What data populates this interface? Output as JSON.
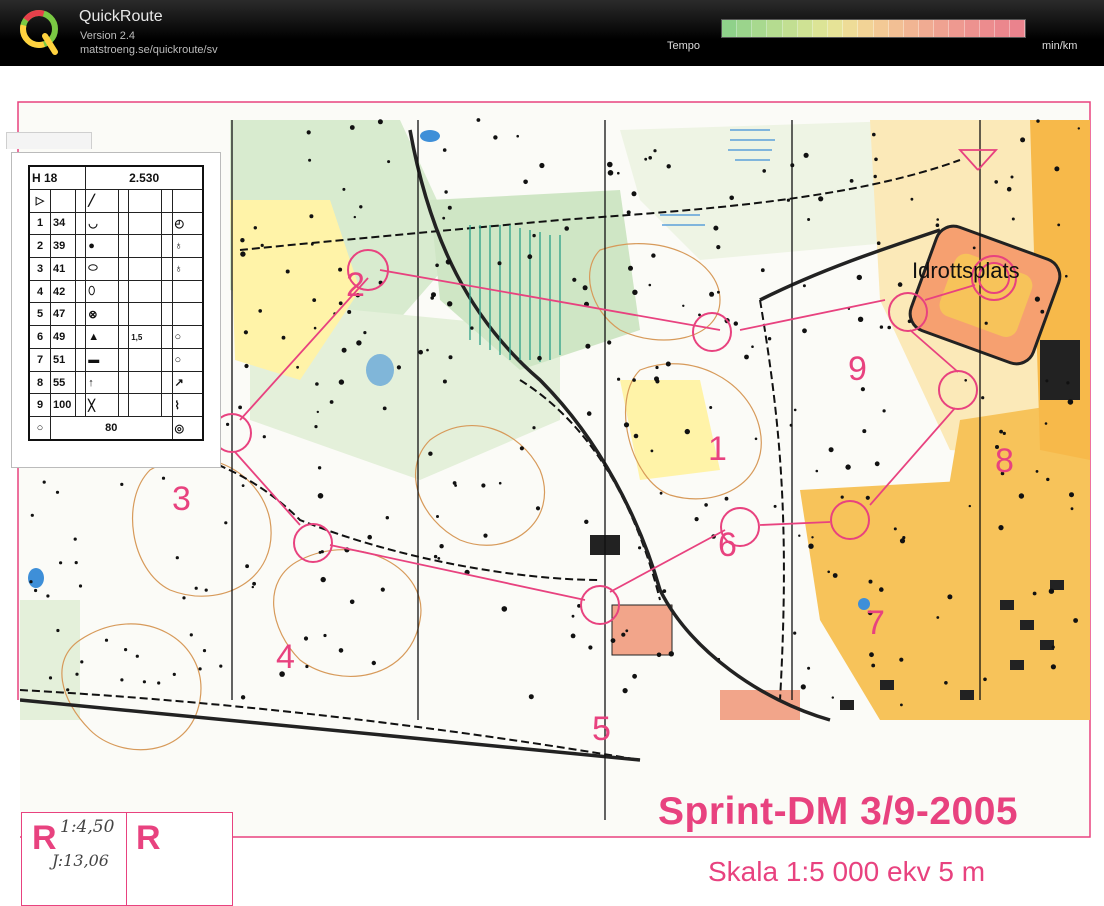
{
  "app": {
    "name": "QuickRoute",
    "version": "Version 2.4",
    "url": "matstroeng.se/quickroute/sv"
  },
  "toolbar": {
    "tempo_label": "Tempo",
    "unit_label": "min/km",
    "gradient_colors": [
      "#8fd18a",
      "#9bd48c",
      "#a8d98f",
      "#b5dc90",
      "#c2df92",
      "#cfe294",
      "#dce496",
      "#e6e397",
      "#eedc97",
      "#f2d396",
      "#f3c995",
      "#f2bf94",
      "#f1b593",
      "#f0ab92",
      "#efa291",
      "#ee9990",
      "#ed928f",
      "#ec8c8e",
      "#eb878d",
      "#ea838d"
    ]
  },
  "map": {
    "title": "Sprint-DM 3/9-2005",
    "scale": "Skala 1:5 000 ekv 5 m",
    "place_name": "Idrottsplats",
    "controls": [
      {
        "num": "1"
      },
      {
        "num": "2"
      },
      {
        "num": "3"
      },
      {
        "num": "4"
      },
      {
        "num": "5"
      },
      {
        "num": "6"
      },
      {
        "num": "7"
      },
      {
        "num": "8"
      },
      {
        "num": "9"
      }
    ]
  },
  "description": {
    "class": "H 18",
    "length": "2.530",
    "total": "80",
    "rows": [
      {
        "n": "1",
        "code": "34"
      },
      {
        "n": "2",
        "code": "39"
      },
      {
        "n": "3",
        "code": "41"
      },
      {
        "n": "4",
        "code": "42"
      },
      {
        "n": "5",
        "code": "47"
      },
      {
        "n": "6",
        "code": "49",
        "extra": "1,5"
      },
      {
        "n": "7",
        "code": "51"
      },
      {
        "n": "8",
        "code": "55"
      },
      {
        "n": "9",
        "code": "100"
      }
    ]
  },
  "legend": {
    "r_left": "R",
    "r_right": "R",
    "hand_time": "1:4,50",
    "hand_total": "J:13,06"
  }
}
